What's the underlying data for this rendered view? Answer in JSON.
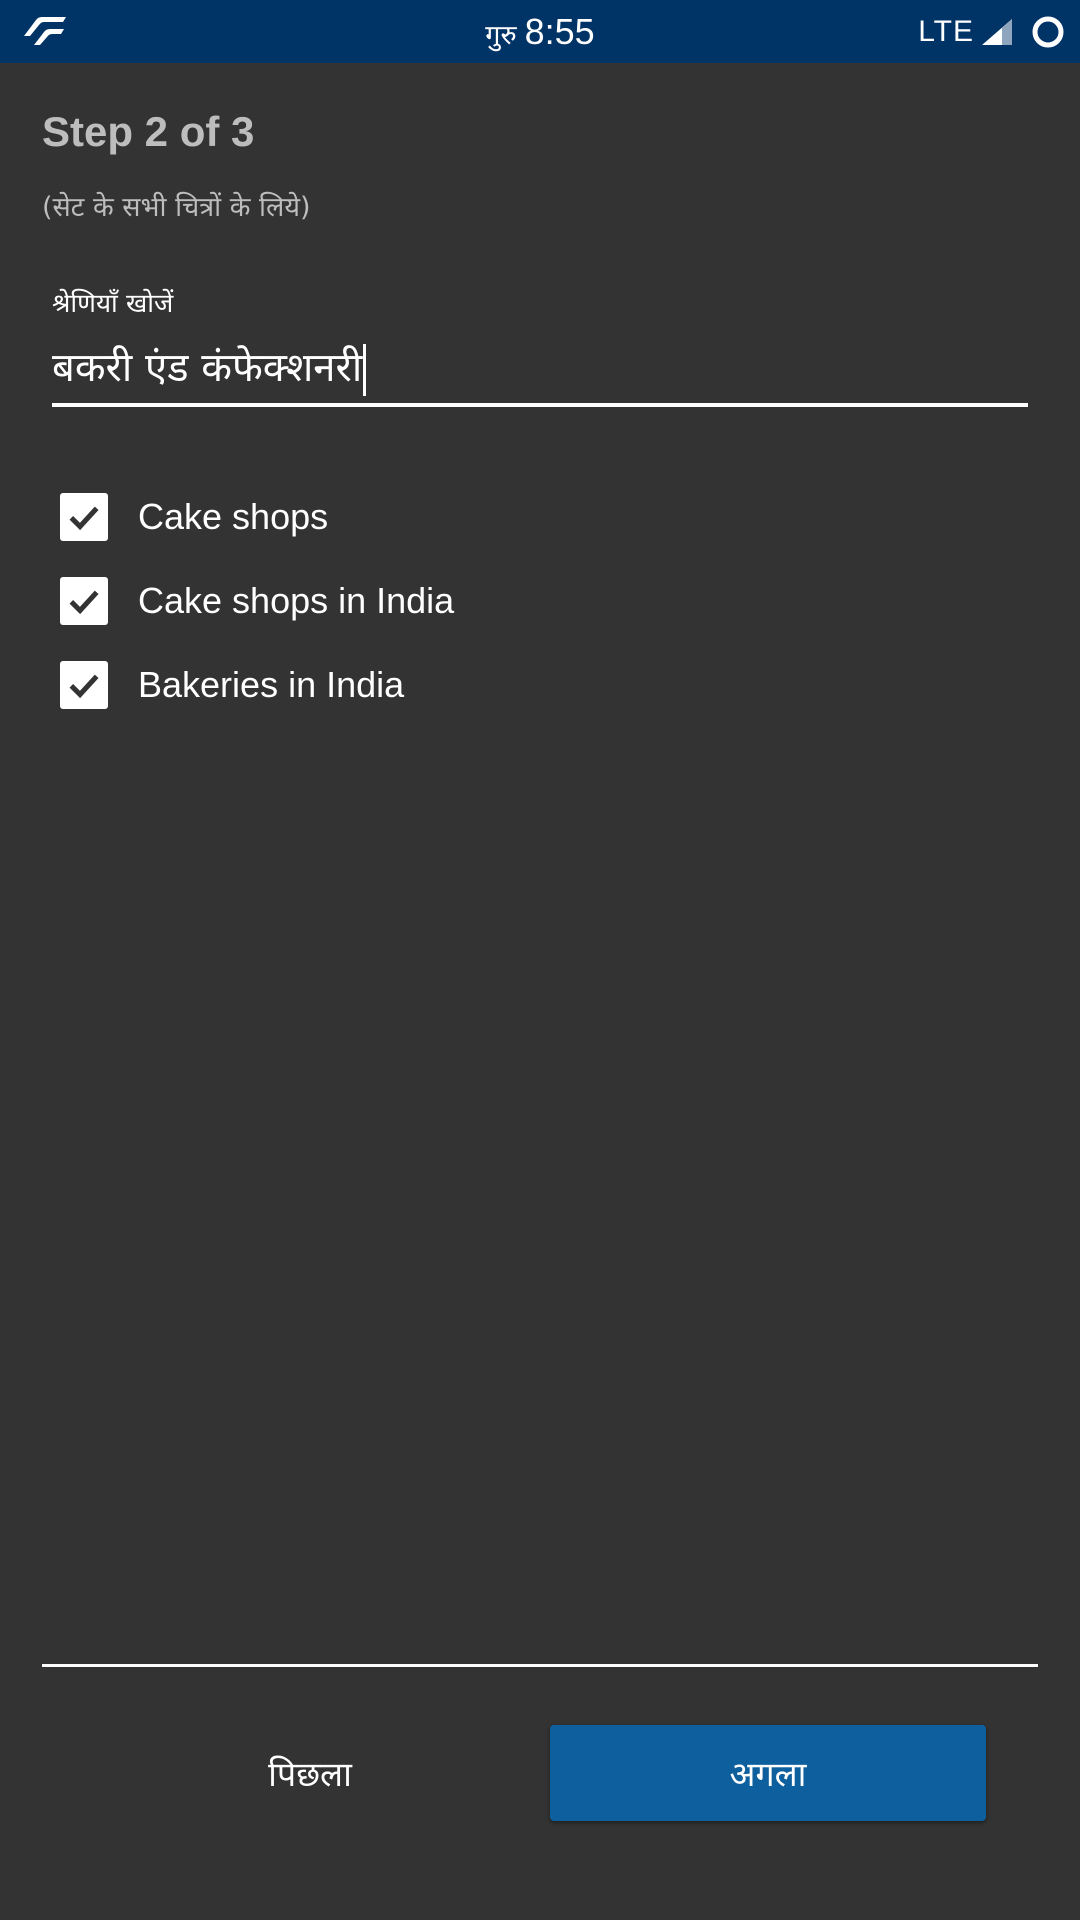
{
  "status_bar": {
    "day": "गुरु",
    "time": "8:55",
    "network": "LTE",
    "background_color": "#003366",
    "icons": [
      "app-logo-icon",
      "signal-icon",
      "battery-icon"
    ]
  },
  "header": {
    "step_title": "Step 2 of 3",
    "subtitle": "(सेट के सभी चित्रों के लिये)"
  },
  "search": {
    "label": "श्रेणियाँ खोजें",
    "value": "बकरी एंड कंफेक्शनरी"
  },
  "categories": [
    {
      "label": "Cake shops",
      "checked": true
    },
    {
      "label": "Cake shops in India",
      "checked": true
    },
    {
      "label": "Bakeries in India",
      "checked": true
    }
  ],
  "footer": {
    "prev_label": "पिछला",
    "next_label": "अगला",
    "next_color": "#0e5f9e"
  },
  "colors": {
    "background": "#333333",
    "muted_text": "#bdbdbd"
  }
}
